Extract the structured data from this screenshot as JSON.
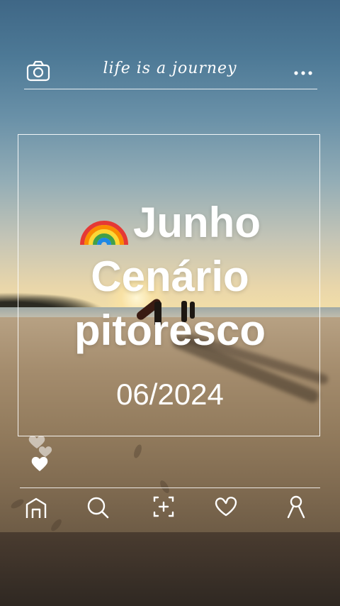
{
  "header": {
    "brand_text": "life is a journey",
    "left_icon": "camera-icon",
    "right_icon": "more-dots-icon"
  },
  "post": {
    "emoji_icon": "rainbow-icon",
    "title_line1": "Junho",
    "title_line2": "Cenário",
    "title_line3": "pitoresco",
    "date": "06/2024"
  },
  "reaction_icon": "hearts-icon",
  "nav": {
    "items": [
      {
        "icon": "home-icon"
      },
      {
        "icon": "search-icon"
      },
      {
        "icon": "add-photo-icon"
      },
      {
        "icon": "heart-icon"
      },
      {
        "icon": "profile-icon"
      }
    ]
  },
  "colors": {
    "overlay_text": "#ffffff",
    "sky_top": "#3f6786",
    "sand": "#a48c6d"
  }
}
